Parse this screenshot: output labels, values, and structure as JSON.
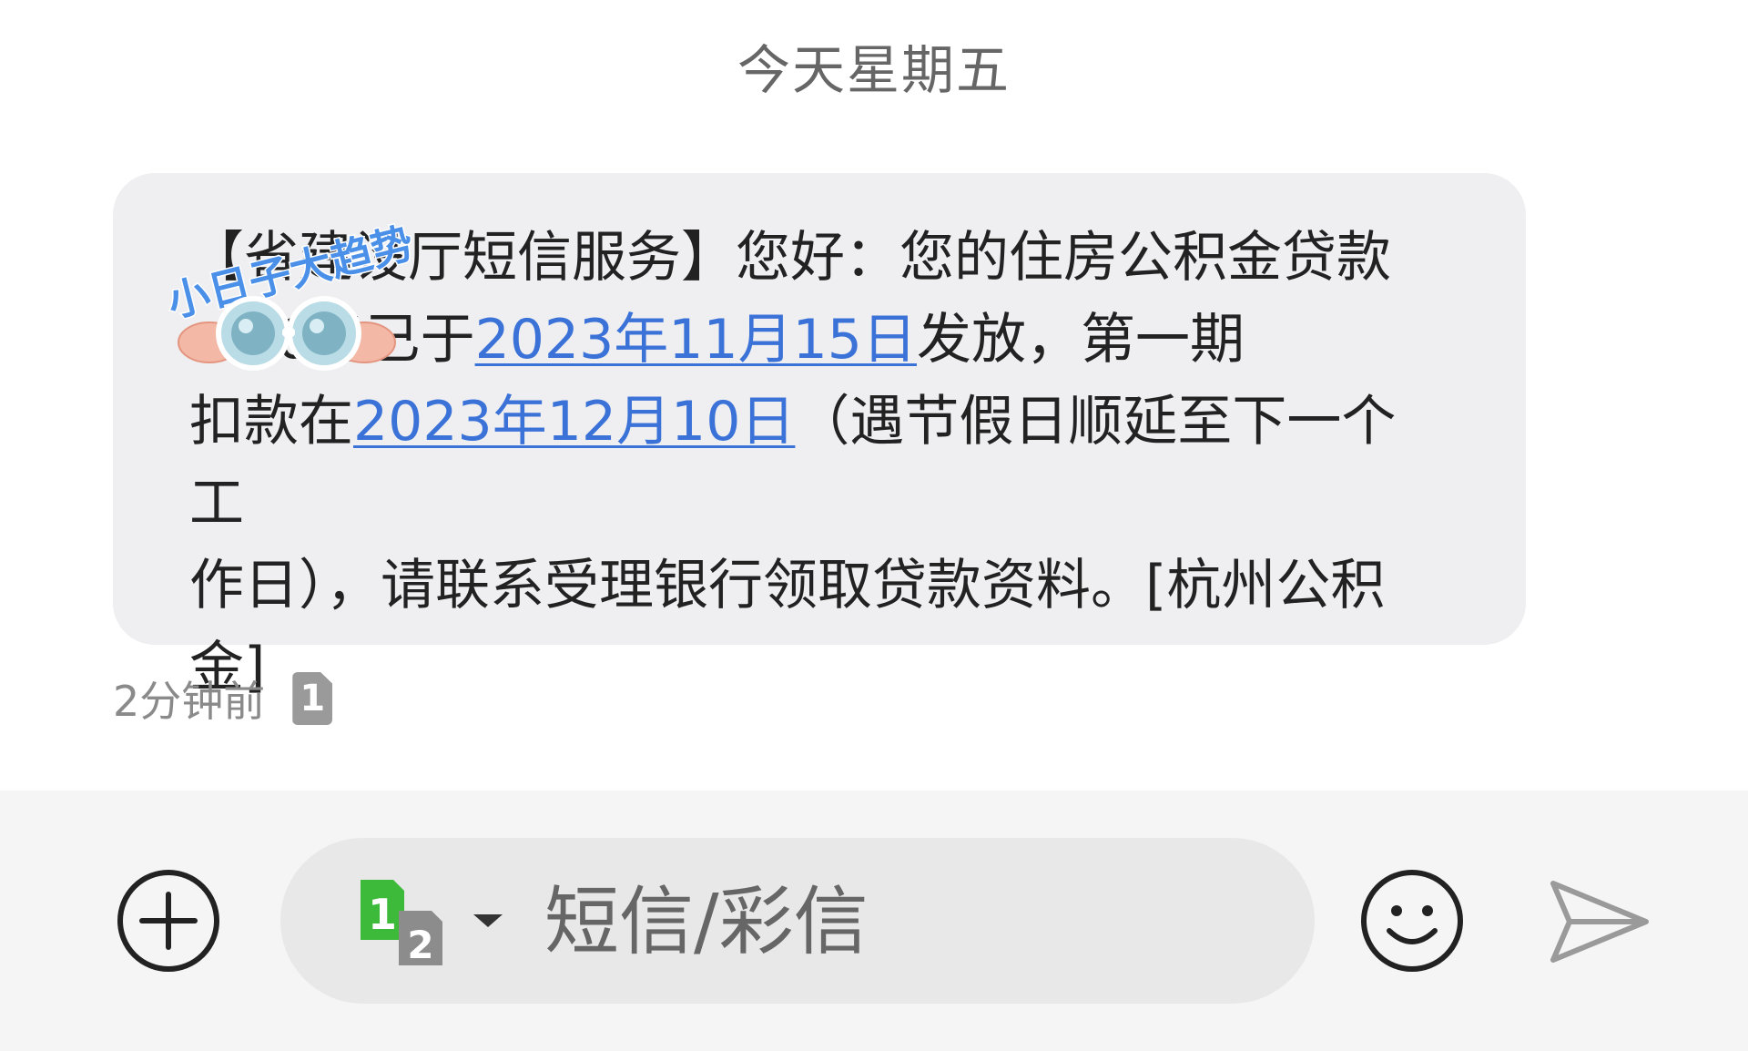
{
  "date_header": "今天星期五",
  "message": {
    "line1": "【省建设厅短信服务】您好：您的住房公积金贷款",
    "line2_prefix": "...00元已于",
    "link_disburse_date": "2023年11月15日",
    "line2_suffix": "发放，第一期",
    "line3_prefix": "扣款在",
    "link_first_debit_date": "2023年12月10日",
    "line3_suffix": "（遇节假日顺延至下一个工",
    "line4": "作日），请联系受理银行领取贷款资料。[杭州公积",
    "line5": "金]"
  },
  "meta": {
    "time": "2分钟前",
    "sim_badge": "1"
  },
  "sticker": {
    "watermark_text": "小日子大趋势"
  },
  "composer": {
    "sim_switch_primary": "1",
    "sim_switch_secondary": "2",
    "placeholder": "短信/彩信"
  },
  "colors": {
    "link": "#3b72d8",
    "bubble": "#efeff1",
    "sim_green": "#3dba3a"
  },
  "icons": {
    "add": "plus-circle-icon",
    "emoji": "smiley-icon",
    "send": "send-arrow-icon",
    "sim_switch": "dual-sim-icon",
    "caret": "caret-down-icon"
  }
}
